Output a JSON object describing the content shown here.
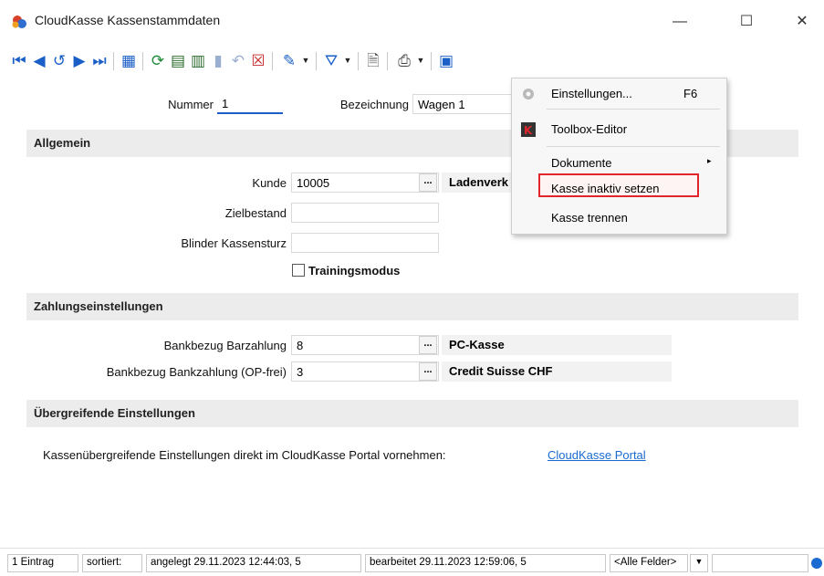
{
  "window": {
    "title": "CloudKasse Kassenstammdaten",
    "minimize_glyph": "—",
    "maximize_glyph": "☐",
    "close_glyph": "✕"
  },
  "toolbar": {
    "icons": [
      "first-record-icon",
      "previous-record-icon",
      "history-back-icon",
      "next-record-icon",
      "last-record-icon",
      "table-view-icon",
      "refresh-icon",
      "new-record-icon",
      "copy-record-icon",
      "save-icon",
      "undo-icon",
      "delete-icon",
      "pin-icon",
      "filter-icon",
      "documents-icon",
      "print-icon",
      "save-disk-icon"
    ],
    "accent_color": "#1a5fc7"
  },
  "form": {
    "nummer_label": "Nummer",
    "nummer_value": "1",
    "bezeichnung_label": "Bezeichnung",
    "bezeichnung_value": "Wagen 1",
    "allgemein": {
      "title": "Allgemein",
      "kunde_label": "Kunde",
      "kunde_value": "10005",
      "kunde_lookup": "...",
      "kunde_name": "Ladenverk",
      "zielbestand_label": "Zielbestand",
      "zielbestand_value": "",
      "blinder_label": "Blinder Kassensturz",
      "blinder_value": "",
      "training_label": "Trainingsmodus",
      "training_checked": false
    },
    "zahlung": {
      "title": "Zahlungseinstellungen",
      "bar_label": "Bankbezug Barzahlung",
      "bar_value": "8",
      "bar_lookup": "...",
      "bar_name": "PC-Kasse",
      "bank_label": "Bankbezug Bankzahlung (OP-frei)",
      "bank_value": "3",
      "bank_lookup": "...",
      "bank_name": "Credit Suisse CHF"
    },
    "uebergreifend": {
      "title": "Übergreifende Einstellungen",
      "text": "Kassenübergreifende Einstellungen direkt im CloudKasse Portal vornehmen:",
      "link": "CloudKasse Portal"
    }
  },
  "context_menu": {
    "items": [
      {
        "label": "Einstellungen...",
        "shortcut": "F6",
        "icon": "settings-icon"
      },
      {
        "label": "Toolbox-Editor",
        "icon": "toolbox-icon"
      },
      {
        "label": "Dokumente",
        "arrow": "▸"
      },
      {
        "label": "Kasse inaktiv setzen",
        "highlighted": true,
        "highlight_color": "#e0262b"
      },
      {
        "label": "Kasse trennen"
      }
    ]
  },
  "statusbar": {
    "count": "1 Eintrag",
    "sort": "sortiert:",
    "created": "angelegt 29.11.2023 12:44:03, 5",
    "edited": "bearbeitet 29.11.2023 12:59:06, 5",
    "field_select": "<Alle Felder>"
  }
}
